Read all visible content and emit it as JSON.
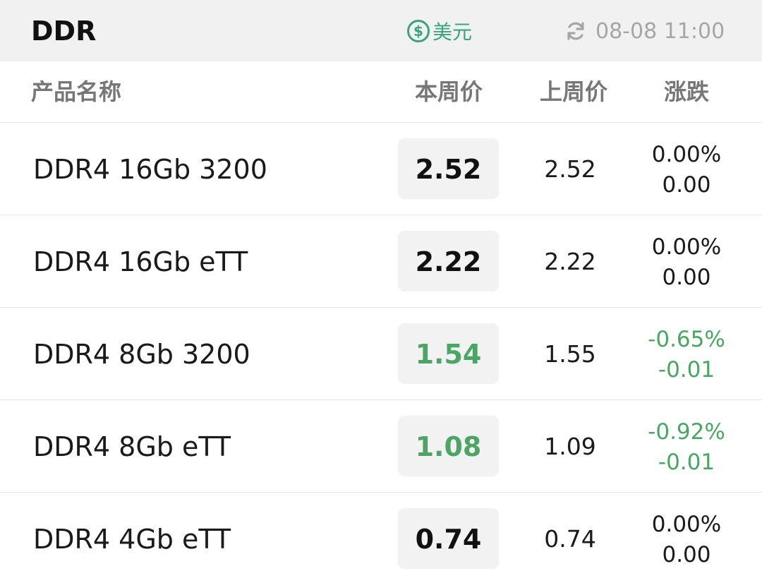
{
  "header": {
    "title": "DDR",
    "currency_symbol": "$",
    "currency_label": "美元",
    "timestamp": "08-08 11:00",
    "refresh_icon": "refresh-icon",
    "accent_color": "#3aa37f"
  },
  "table": {
    "columns": {
      "name": "产品名称",
      "this_week": "本周价",
      "last_week": "上周价",
      "change": "涨跌"
    },
    "rows": [
      {
        "name": "DDR4 16Gb 3200",
        "this_week": "2.52",
        "last_week": "2.52",
        "change_pct": "0.00%",
        "change_abs": "0.00",
        "trend": "flat"
      },
      {
        "name": "DDR4 16Gb eTT",
        "this_week": "2.22",
        "last_week": "2.22",
        "change_pct": "0.00%",
        "change_abs": "0.00",
        "trend": "flat"
      },
      {
        "name": "DDR4 8Gb 3200",
        "this_week": "1.54",
        "last_week": "1.55",
        "change_pct": "-0.65%",
        "change_abs": "-0.01",
        "trend": "down"
      },
      {
        "name": "DDR4 8Gb eTT",
        "this_week": "1.08",
        "last_week": "1.09",
        "change_pct": "-0.92%",
        "change_abs": "-0.01",
        "trend": "down"
      },
      {
        "name": "DDR4 4Gb eTT",
        "this_week": "0.74",
        "last_week": "0.74",
        "change_pct": "0.00%",
        "change_abs": "0.00",
        "trend": "flat"
      }
    ],
    "down_color": "#4ba565"
  }
}
